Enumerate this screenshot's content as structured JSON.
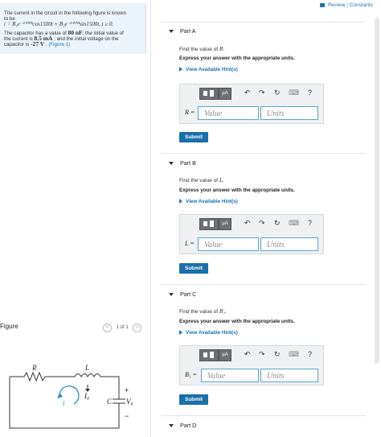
{
  "header": {
    "review_label": "Review",
    "separator": "|",
    "constants_label": "Constants"
  },
  "problem": {
    "line1": "The current in the circuit in the following figure is known",
    "line2": "to be",
    "equation": "i = B₁e⁻²⁰⁰⁰ᵗcos1500t + B₂e⁻²⁰⁰⁰ᵗsin1500t, t ≥ 0.",
    "line3a": "The capacitor has a value of ",
    "cap_value": "80 nF",
    "line3b": "; the initial value of",
    "line4a": "the current is ",
    "i_value": "8.5 mA",
    "line4b": " ; and the initial voltage on the",
    "line5a": "capacitor is ",
    "v_value": "-27 V",
    "line5b": " . ",
    "figure_link": "(Figure 1)"
  },
  "figure": {
    "label": "Figure",
    "pager": "1 of 1",
    "prev": "<",
    "next": ">",
    "R": "R",
    "L": "L",
    "I0": "I₀",
    "i": "i",
    "C": "C",
    "V0": "V₀",
    "plus": "+",
    "minus": "−"
  },
  "parts": [
    {
      "title": "Part A",
      "find": "Find the value of ",
      "var": "R",
      "express": "Express your answer with the appropriate units.",
      "hint": "View Available Hint(s)",
      "eq_label": "R =",
      "value_ph": "Value",
      "units_ph": "Units",
      "submit": "Submit"
    },
    {
      "title": "Part B",
      "find": "Find the value of ",
      "var": "L",
      "express": "Express your answer with the appropriate units.",
      "hint": "View Available Hint(s)",
      "eq_label": "L =",
      "value_ph": "Value",
      "units_ph": "Units",
      "submit": "Submit"
    },
    {
      "title": "Part C",
      "find": "Find the value of ",
      "var": "B₁",
      "express": "Express your answer with the appropriate units.",
      "hint": "View Available Hint(s)",
      "eq_label": "B₁ =",
      "value_ph": "Value",
      "units_ph": "Units",
      "submit": "Submit"
    },
    {
      "title": "Part D"
    }
  ],
  "toolbar": {
    "mu": "μA",
    "undo": "↶",
    "redo": "↷",
    "reset": "↻",
    "keyboard": "⌨",
    "help": "?"
  }
}
